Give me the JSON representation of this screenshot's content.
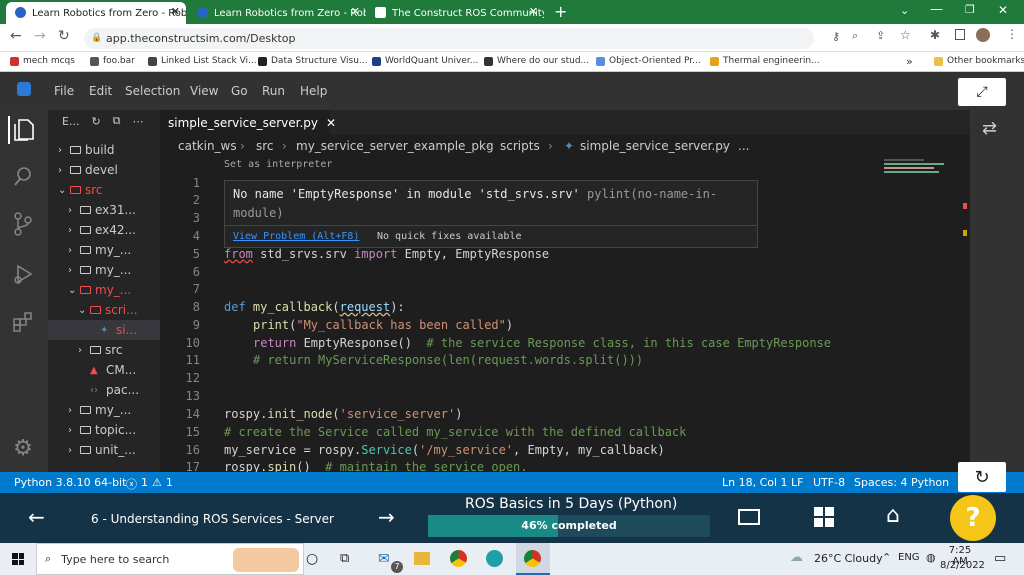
{
  "browser": {
    "tabs": [
      {
        "label": "Learn Robotics from Zero - Robo",
        "active": true
      },
      {
        "label": "Learn Robotics from Zero - Robo",
        "active": false
      },
      {
        "label": "The Construct ROS Community",
        "active": false
      }
    ],
    "new_tab": "+",
    "url": "app.theconstructsim.com/Desktop",
    "bookmarks": [
      "mech mcqs",
      "foo.bar",
      "Linked List Stack Vi...",
      "Data Structure Visu...",
      "WorldQuant Univer...",
      "Where do our stud...",
      "Object-Oriented Pr...",
      "Thermal engineerin..."
    ],
    "bookmarks_more": "»",
    "other_bookmarks": "Other bookmarks"
  },
  "ide": {
    "menu": [
      "File",
      "Edit",
      "Selection",
      "View",
      "Go",
      "Run",
      "Help"
    ],
    "explorer_title": "E...",
    "tree": [
      {
        "label": "build",
        "indent": 0,
        "open": false,
        "color": "#cccccc"
      },
      {
        "label": "devel",
        "indent": 0,
        "open": false,
        "color": "#cccccc"
      },
      {
        "label": "src",
        "indent": 0,
        "open": true,
        "color": "#f14c4c"
      },
      {
        "label": "ex31...",
        "indent": 1,
        "open": false,
        "color": "#cccccc"
      },
      {
        "label": "ex42...",
        "indent": 1,
        "open": false,
        "color": "#cccccc"
      },
      {
        "label": "my_...",
        "indent": 1,
        "open": false,
        "color": "#cccccc"
      },
      {
        "label": "my_...",
        "indent": 1,
        "open": false,
        "color": "#cccccc"
      },
      {
        "label": "my_...",
        "indent": 1,
        "open": true,
        "color": "#f14c4c"
      },
      {
        "label": "scri...",
        "indent": 2,
        "open": true,
        "color": "#f14c4c"
      },
      {
        "label": "si...",
        "indent": 3,
        "open": null,
        "color": "#f14c4c"
      },
      {
        "label": "src",
        "indent": 2,
        "open": false,
        "color": "#cccccc"
      },
      {
        "label": "CM...",
        "indent": 2,
        "open": null,
        "color": "#cccccc"
      },
      {
        "label": "pac...",
        "indent": 2,
        "open": null,
        "color": "#cccccc"
      },
      {
        "label": "my_...",
        "indent": 1,
        "open": false,
        "color": "#cccccc"
      },
      {
        "label": "topic...",
        "indent": 1,
        "open": false,
        "color": "#cccccc"
      },
      {
        "label": "unit_...",
        "indent": 1,
        "open": false,
        "color": "#cccccc"
      }
    ],
    "editor_tab": "simple_service_server.py",
    "breadcrumb": [
      "catkin_ws",
      "src",
      "my_service_server_example_pkg",
      "scripts",
      "simple_service_server.py",
      "..."
    ],
    "set_interpreter": "Set as interpreter",
    "hover_message": "No name 'EmptyResponse' in module 'std_srvs.srv'",
    "hover_source": "pylint(no-name-in-",
    "hover_source2": "module)",
    "view_problem": "View Problem (Alt+F8)",
    "no_fixes": "No quick fixes available",
    "code": {
      "n1": "1",
      "n2": "2",
      "n3": "3",
      "n4": "4",
      "n5": "5",
      "n6": "6",
      "n7": "7",
      "n8": "8",
      "n9": "9",
      "n10": "10",
      "n11": "11",
      "n12": "12",
      "n13": "13",
      "n14": "14",
      "n15": "15",
      "n16": "16",
      "n17": "17",
      "l5_from": "from",
      "l5_mod": " std_srvs.srv ",
      "l5_import": "import",
      "l5_names": " Empty, EmptyResponse",
      "l8_def": "def",
      "l8_fn": " my_callback",
      "l8_p1": "(",
      "l8_param": "request",
      "l8_p2": "):",
      "l9_fn": "print",
      "l9_str": "\"My_callback has been called\"",
      "l10_ret": "return",
      "l10_cls": " EmptyResponse",
      "l10_paren": "()  ",
      "l10_cm": "# the service Response class, in this case EmptyResponse",
      "l11_cm": "# return MyServiceResponse(len(request.words.split()))",
      "l14_a": "rospy.",
      "l14_fn": "init_node",
      "l14_b": "(",
      "l14_str": "'service_server'",
      "l14_c": ")",
      "l15_cm": "# create the Service called my_service with the defined callback",
      "l16_a": "my_service = rospy.",
      "l16_fn": "Service",
      "l16_b": "(",
      "l16_str": "'/my_service'",
      "l16_c": ", Empty, my_callback)",
      "l17_a": "rospy.",
      "l17_fn": "spin",
      "l17_b": "()  ",
      "l17_cm": "# maintain the service open."
    }
  },
  "statusbar": {
    "python": "Python 3.8.10 64-bit",
    "errors": "1",
    "warnings": "1",
    "position": "Ln 18, Col 1",
    "eol": "LF",
    "encoding": "UTF-8",
    "spaces": "Spaces: 4",
    "language": "Python"
  },
  "course": {
    "unit": "6 - Understanding ROS Services - Server",
    "title": "ROS Basics in 5 Days (Python)",
    "progress_text": "46% completed",
    "progress": 0.46,
    "help": "?"
  },
  "taskbar": {
    "search_placeholder": "Type here to search",
    "weather": "26°C  Cloudy",
    "lang": "ENG",
    "time": "7:25 AM",
    "date": "8/2/2022",
    "badge": "7"
  }
}
